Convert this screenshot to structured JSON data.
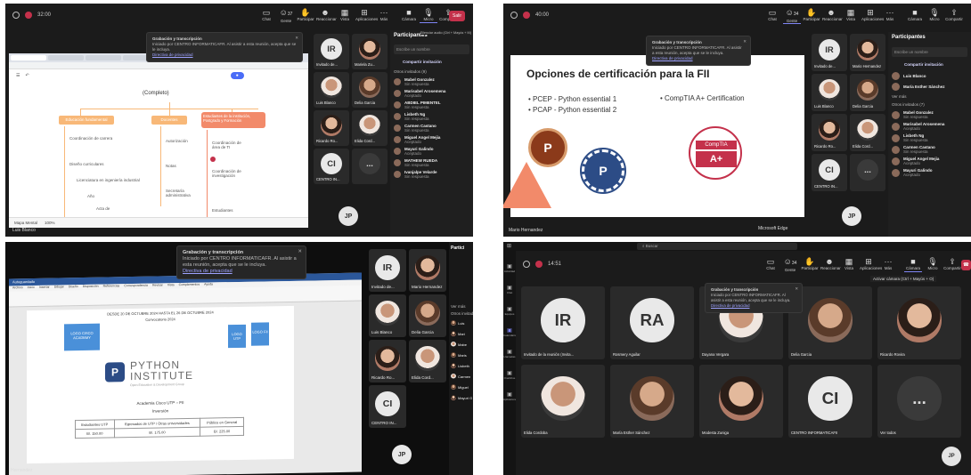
{
  "q1": {
    "timer": "32:00",
    "toolbar": [
      "Chat",
      "Gente",
      "Participar",
      "Reaccionar",
      "Vista",
      "Aplicaciones",
      "Más",
      "Cámara",
      "Micro",
      "Compartir"
    ],
    "people_count": "37",
    "leave": "Salir",
    "notice": {
      "title": "Grabación y transcripción",
      "body": "Iniciado por CENTRO INFORMATICAFR. Al asistir a esta reunión, acepta que se le incluya.",
      "link": "Directiva de privacidad"
    },
    "share_label": "Mapa Mental",
    "zoom": "100%",
    "diagram": {
      "heading": "(Completo)",
      "col1": [
        "Educación fundamental",
        "Coordinación de carrera",
        "Diseño curriculares",
        "Licenciatura en ingeniería industrial",
        "Año",
        "Acta de"
      ],
      "col2": [
        "Docentes",
        "Autorización",
        "Notas",
        "Secretaría administrativa"
      ],
      "col3": [
        "Estudiantes de la institución, Postgrado y Formación",
        "Coordinación de área de TI",
        "Coordinación de investigación",
        "Estudiantes"
      ]
    },
    "presenter": "Luis Blanco",
    "participants_panel": {
      "title": "Participantes",
      "mute_hint": "Silenciar audio (Ctrl + Mayús + M)",
      "search": "Escribe un nombre",
      "share": "Compartir invitación",
      "section": "Otros invitados (9)",
      "people": [
        {
          "name": "Mabel Gonzalez",
          "status": "Sin respuesta"
        },
        {
          "name": "Marisabel Arosemena",
          "status": "Aceptado"
        },
        {
          "name": "ABDIEL PIMENTEL",
          "status": "Sin respuesta"
        },
        {
          "name": "Lisbeth Ng",
          "status": "Sin respuesta"
        },
        {
          "name": "Carmen Castano",
          "status": "Sin respuesta"
        },
        {
          "name": "Miguel Angel Mejia",
          "status": "Aceptado"
        },
        {
          "name": "Mayuri Galindo",
          "status": "Aceptado"
        },
        {
          "name": "MATHEW RUEDA",
          "status": "Sin respuesta"
        },
        {
          "name": "Ivanjalpe Velarde",
          "status": "Sin respuesta"
        }
      ]
    },
    "tiles": [
      {
        "initials": "IR",
        "name": "Invitado de..."
      },
      {
        "initials": "",
        "name": "Mariela Zu..."
      },
      {
        "initials": "",
        "name": "Luis Blanco"
      },
      {
        "initials": "",
        "name": "Delia Garcia"
      },
      {
        "initials": "",
        "name": "Ricardo Ro..."
      },
      {
        "initials": "",
        "name": "Elida Cord..."
      },
      {
        "initials": "CI",
        "name": "CENTRO IN..."
      },
      {
        "initials": "...",
        "name": ""
      }
    ],
    "self": "JP"
  },
  "q2": {
    "timer": "40:00",
    "people_count": "34",
    "notice": {
      "title": "Grabación y transcripción",
      "body": "Iniciado por CENTRO INFORMATICAFR. Al asistir a esta reunión, acepta que se le incluya.",
      "link": "Directiva de privacidad"
    },
    "slide": {
      "title": "Opciones de certificación para la FII",
      "left": [
        "PCEP - Python essential 1",
        "PCAP - Python essential 2"
      ],
      "right": [
        "CompTIA A+ Certification"
      ],
      "badge1": "P",
      "badge2": "P",
      "comptia": "CompTIA",
      "aplus": "A+"
    },
    "presenter": "Mario Hernandez",
    "app_label": "Microsoft Edge",
    "tiles": [
      {
        "initials": "IR",
        "name": "Invitado de..."
      },
      {
        "initials": "",
        "name": "Mario Hernandez"
      },
      {
        "initials": "",
        "name": "Luis Blanco"
      },
      {
        "initials": "",
        "name": "Delia Garcia"
      },
      {
        "initials": "",
        "name": "Ricardo Ro..."
      },
      {
        "initials": "",
        "name": "Elida Cord..."
      },
      {
        "initials": "CI",
        "name": "CENTRO IN..."
      },
      {
        "initials": "...",
        "name": ""
      }
    ],
    "self": "JP",
    "panel": {
      "title": "Participantes",
      "search": "Escribe un nombre",
      "share": "Compartir invitación",
      "top": [
        {
          "name": "Luis Blanco"
        },
        {
          "name": "María Esther Sánchez"
        }
      ],
      "more": "Ver más",
      "section": "Otros invitados (7)",
      "people": [
        {
          "name": "Mabel Gonzalez",
          "status": "Sin respuesta"
        },
        {
          "name": "Marisabel Arosemena",
          "status": "Aceptado"
        },
        {
          "name": "Lisbeth Ng",
          "status": "Sin respuesta"
        },
        {
          "name": "Carmen Castano",
          "status": "Sin respuesta"
        },
        {
          "name": "Miguel Angel Mejia",
          "status": "Aceptado"
        },
        {
          "name": "Mayuri Galindo",
          "status": "Aceptado"
        }
      ]
    }
  },
  "q3": {
    "notice": {
      "title": "Grabación y transcripción",
      "body": "Iniciado por CENTRO INFORMATICAFR. Al asistir a esta reunión, acepta que se le incluya.",
      "link": "Directiva de privacidad"
    },
    "word_title": "Autoguardado",
    "ribbon": [
      "Archivo",
      "Inicio",
      "Insertar",
      "Dibujar",
      "Diseño",
      "Disposición",
      "Referencias",
      "Correspondencia",
      "Revisar",
      "Vista",
      "Complementos",
      "Ayuda"
    ],
    "doc_date": "DESDE 20 DE OCTUBRE 2024 HASTA EL 26 DE OCTUBRE 2024",
    "doc_sub": "Convocatoria 2024",
    "boxes": [
      "LOGO CISCO ACADEMY",
      "LOGO UTP",
      "LOGO FII"
    ],
    "logo_line1": "PYTHON",
    "logo_line2": "INSTITUTE",
    "logo_tag": "Open Education & Development Group",
    "table_title": "Academia Cisco UTP – FII",
    "table_sub": "Inversión",
    "table_headers": [
      "Estudiantes UTP",
      "Egresados de UTP / Otras universidades",
      "Público en General"
    ],
    "table_values": [
      "B/. 150.00",
      "B/. 175.00",
      "B/. 225.00"
    ],
    "presenter": "Hernandez",
    "tiles": [
      {
        "initials": "IR",
        "name": "Invitado de..."
      },
      {
        "initials": "",
        "name": "Mario Hernandez"
      },
      {
        "initials": "",
        "name": "Luis Blanco"
      },
      {
        "initials": "",
        "name": "Delia Garcia"
      },
      {
        "initials": "",
        "name": "Ricardo Ro..."
      },
      {
        "initials": "",
        "name": "Elida Cord..."
      },
      {
        "initials": "CI",
        "name": "CENTRO IN..."
      }
    ],
    "self": "JP",
    "side": {
      "title": "Partici",
      "more": "Ver más",
      "section": "Otros invitad",
      "names": [
        "Luis",
        "Marí",
        "Mabe",
        "Maris",
        "Lisbeth",
        "Carmen",
        "Miguel",
        "Mayuri G"
      ]
    }
  },
  "q4": {
    "timer": "14:51",
    "search": "Buscar",
    "people_count": "34",
    "cam_hint": "Activar cámara (Ctrl + Mayús + O)",
    "notice": {
      "title": "Grabación y transcripción",
      "body": "Iniciado por CENTRO INFORMATICAFR. Al asistir a esta reunión, acepta que se le incluya.",
      "link": "Directiva de privacidad"
    },
    "rail": [
      "Actividad",
      "Chat",
      "Equipos",
      "Calendario",
      "Llamadas",
      "OneDrive",
      "Aplicaciones"
    ],
    "tiles": [
      {
        "initials": "IR",
        "name": "Invitado de la reunión (Invita..."
      },
      {
        "initials": "RA",
        "name": "Rosmery Aguilar"
      },
      {
        "initials": "",
        "name": "Dayana Vergara"
      },
      {
        "initials": "",
        "name": "Delia Garcia"
      },
      {
        "initials": "",
        "name": "Ricardo Rovira"
      },
      {
        "initials": "",
        "name": "Elida Cordoba"
      },
      {
        "initials": "",
        "name": "María Esther Sánchez"
      },
      {
        "initials": "",
        "name": "Modesta Zuniga"
      },
      {
        "initials": "CI",
        "name": "CENTRO INFORMATICAFII"
      },
      {
        "initials": "...",
        "name": "Ver todos"
      }
    ],
    "self": "JP"
  },
  "colors": {
    "teams_bg": "#1b1b1b",
    "accent": "#7f85f5",
    "leave": "#c4314b",
    "orange": "#f8b878",
    "coral": "#f28a6a"
  }
}
